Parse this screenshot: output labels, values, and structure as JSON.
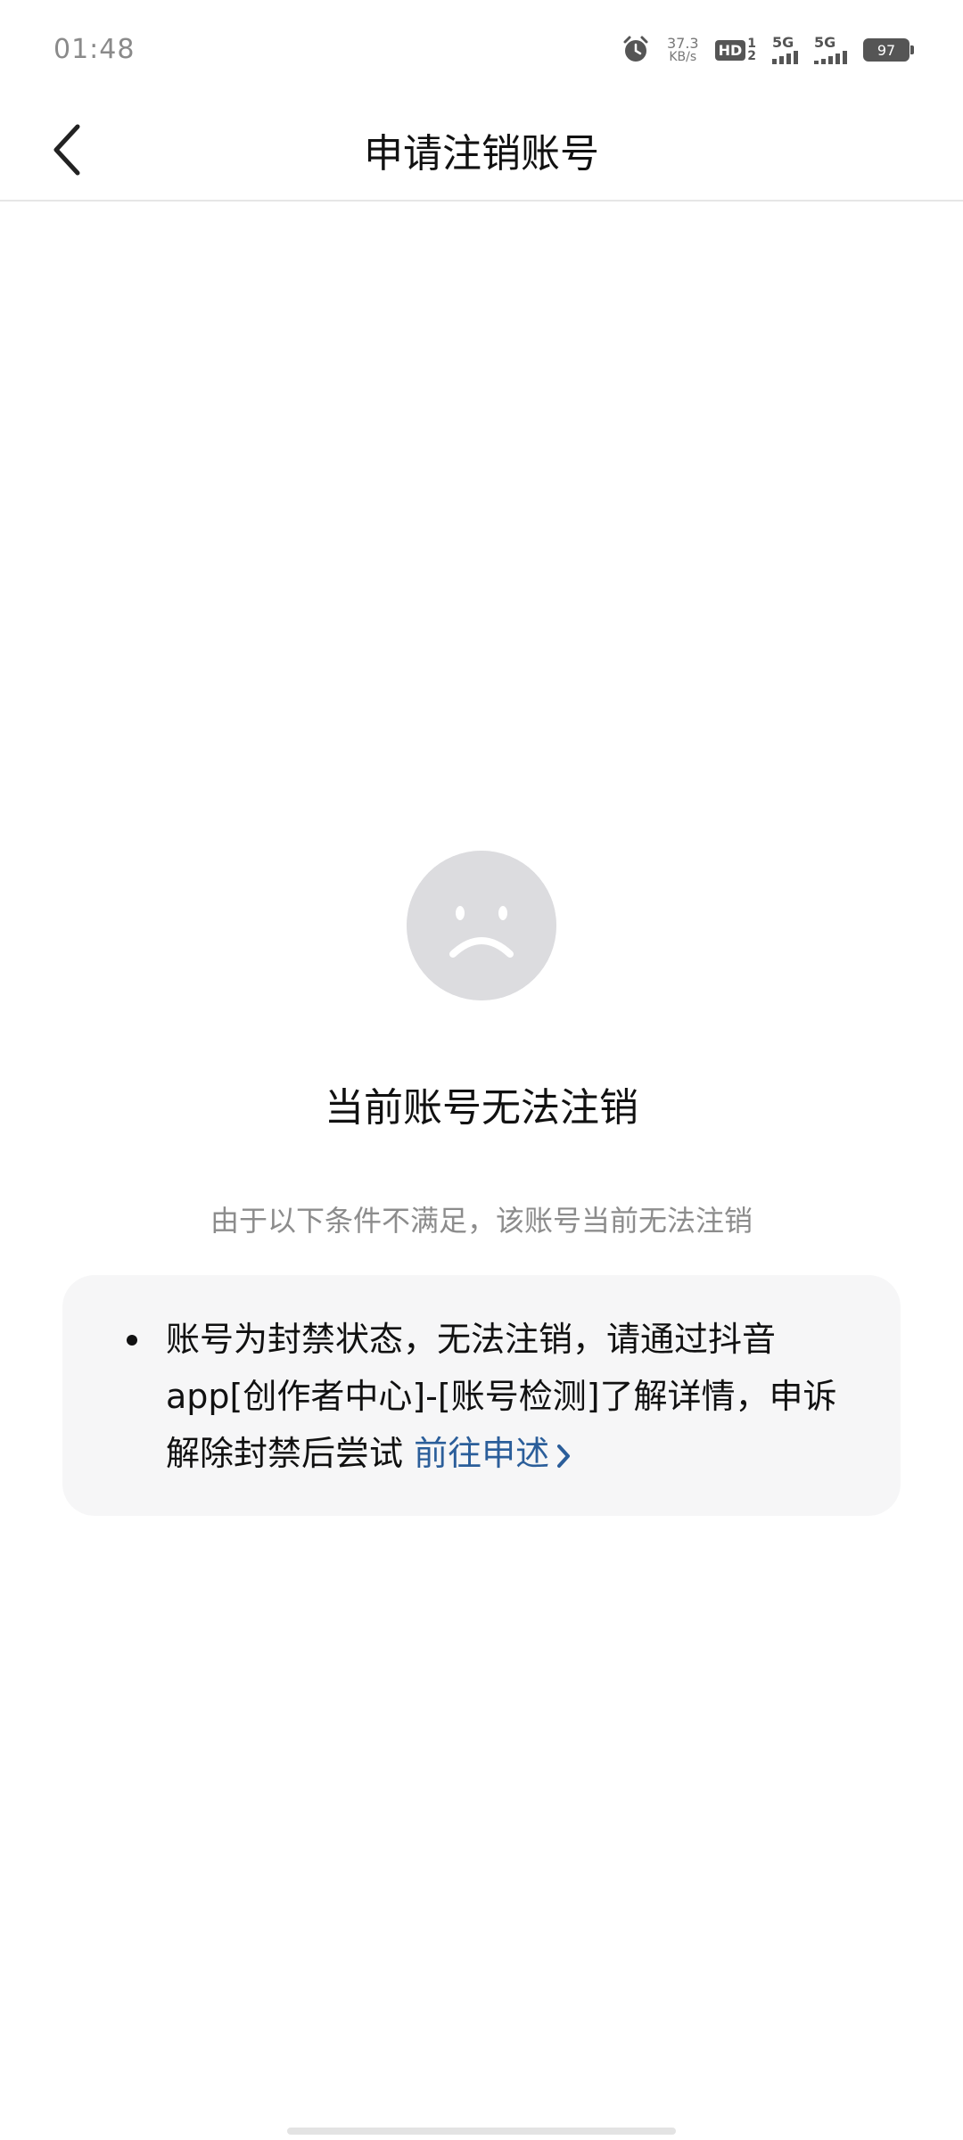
{
  "status_bar": {
    "time": "01:48",
    "net_speed_value": "37.3",
    "net_speed_unit": "KB/s",
    "hd_label": "HD",
    "hd_sub_top": "1",
    "hd_sub_bottom": "2",
    "signal1_label": "5G",
    "signal2_label": "5G",
    "battery": "97"
  },
  "header": {
    "title": "申请注销账号"
  },
  "main": {
    "title": "当前账号无法注销",
    "subtitle": "由于以下条件不满足，该账号当前无法注销",
    "reasons": [
      {
        "text": "账号为封禁状态，无法注销，请通过抖音app[创作者中心]-[账号检测]了解详情，申诉解除封禁后尝试 ",
        "link_label": "前往申述"
      }
    ]
  },
  "colors": {
    "link": "#2b5e9a",
    "card_bg": "#f6f6f7",
    "face": "#dcdcdf"
  }
}
